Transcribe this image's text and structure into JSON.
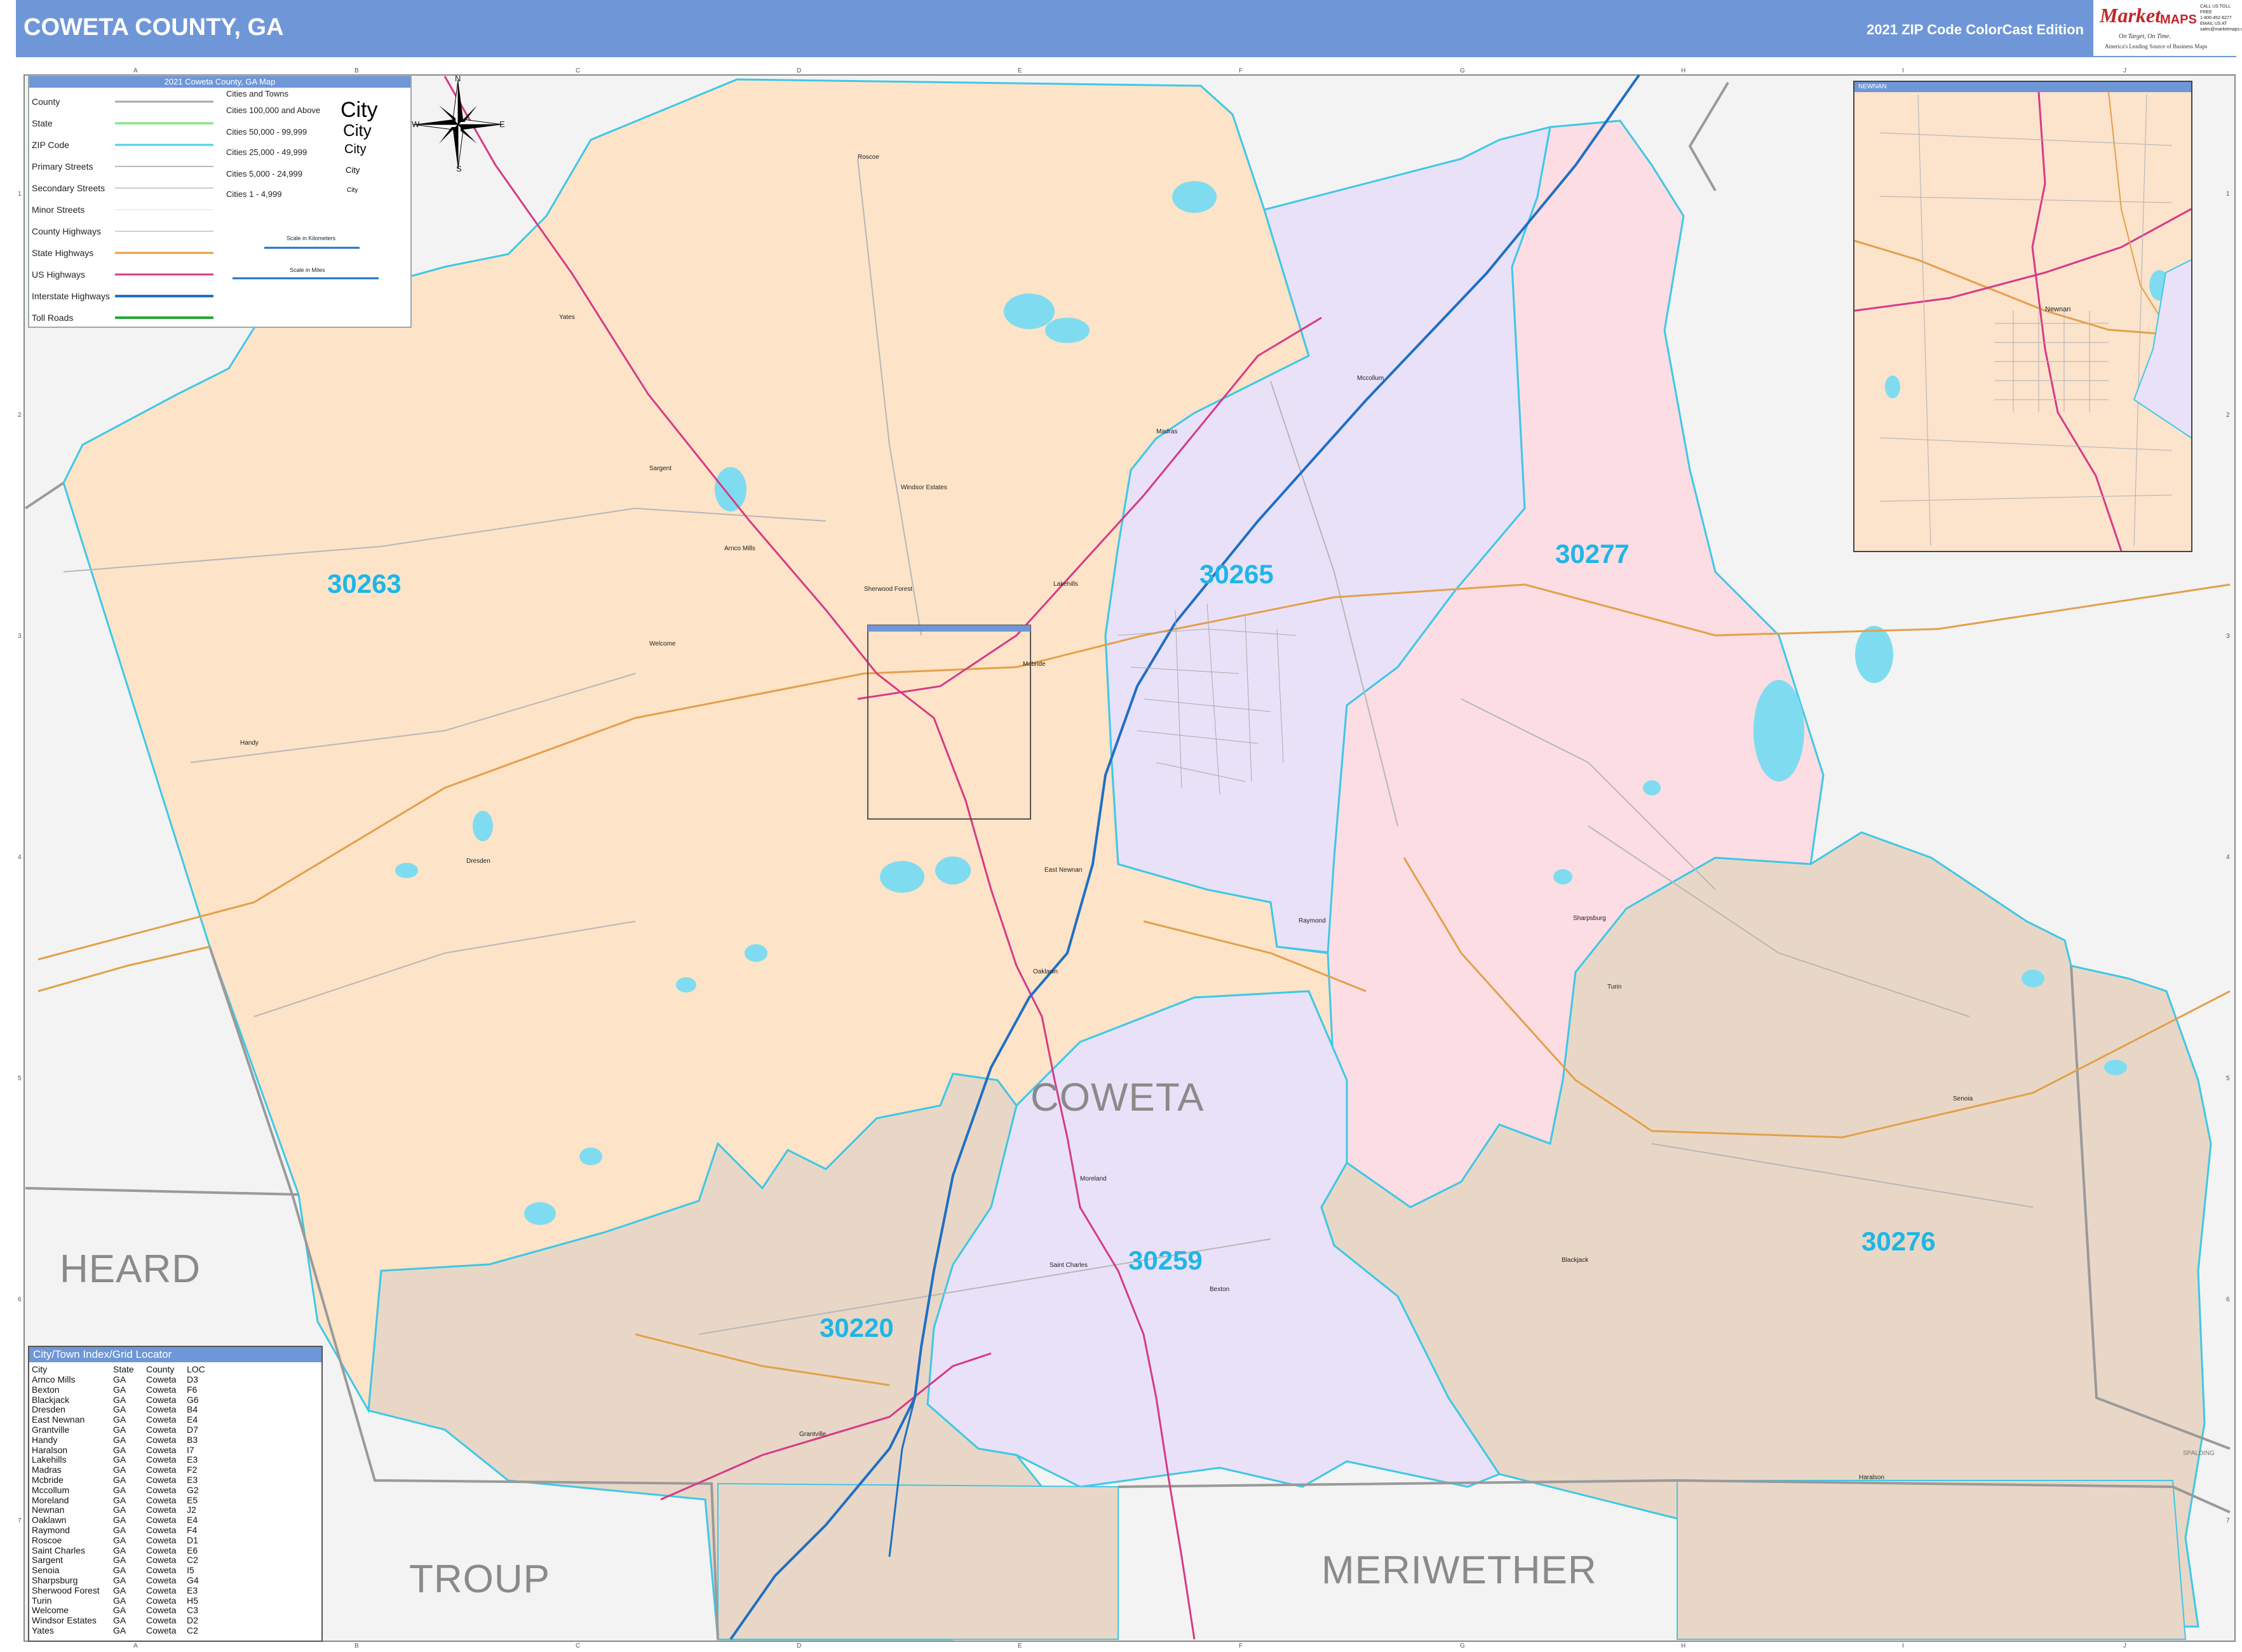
{
  "header": {
    "title": "COWETA COUNTY, GA",
    "edition": "2021 ZIP Code ColorCast Edition",
    "logo": {
      "brand_a": "Market",
      "brand_b": "MAPS",
      "tagline": "On Target, On Time.",
      "tagline2": "America's Leading Source of Business Maps",
      "contact": [
        "CALL US TOLL FREE",
        "1-800-452-6277",
        "EMAIL US AT",
        "sales@marketmaps.com"
      ]
    }
  },
  "grid": {
    "columns": [
      "A",
      "B",
      "C",
      "D",
      "E",
      "F",
      "G",
      "H",
      "I",
      "J"
    ],
    "rows": [
      "1",
      "2",
      "3",
      "4",
      "5",
      "6",
      "7"
    ]
  },
  "legend": {
    "title": "2021 Coweta County, GA Map",
    "items": [
      {
        "label": "County",
        "color": "#aaaaaa"
      },
      {
        "label": "State",
        "color": "#9be59b"
      },
      {
        "label": "ZIP Code",
        "color": "#4fd0e8"
      },
      {
        "label": "Primary Streets",
        "color": "#bbbbbb"
      },
      {
        "label": "Secondary Streets",
        "color": "#cccccc"
      },
      {
        "label": "Minor Streets",
        "color": "#dddddd"
      },
      {
        "label": "County Highways",
        "color": "#c7d2de"
      },
      {
        "label": "State Highways",
        "color": "#e3a04a"
      },
      {
        "label": "US Highways",
        "color": "#d63a86"
      },
      {
        "label": "Interstate Highways",
        "color": "#1f6fc4"
      },
      {
        "label": "Toll Roads",
        "color": "#22aa33"
      }
    ],
    "cities_heading": "Cities and Towns",
    "city_tiers": [
      {
        "label": "Cities 100,000 and Above",
        "sample": "City"
      },
      {
        "label": "Cities 50,000 - 99,999",
        "sample": "City"
      },
      {
        "label": "Cities 25,000 - 49,999",
        "sample": "City"
      },
      {
        "label": "Cities 5,000 - 24,999",
        "sample": "City"
      },
      {
        "label": "Cities 1 - 4,999",
        "sample": "City"
      }
    ],
    "scale_km": "Scale in Kilometers",
    "scale_mi": "Scale in Miles"
  },
  "compass": {
    "n": "N",
    "s": "S",
    "e": "E",
    "w": "W"
  },
  "zip_codes": [
    {
      "code": "30263",
      "color": "#fde3c8"
    },
    {
      "code": "30265",
      "color": "#e9e1f8"
    },
    {
      "code": "30277",
      "color": "#fcdde3"
    },
    {
      "code": "30259",
      "color": "#e9e1f8"
    },
    {
      "code": "30220",
      "color": "#e8d7c7"
    },
    {
      "code": "30276",
      "color": "#e8d7c7"
    }
  ],
  "counties": {
    "main": "COWETA",
    "neighbors": [
      "HEARD",
      "TROUP",
      "MERIWETHER"
    ],
    "small": [
      "SPALDING"
    ]
  },
  "towns": [
    "Roscoe",
    "Yates",
    "Sargent",
    "Windsor Estates",
    "Arnco Mills",
    "Sherwood Forest",
    "Lakehills",
    "Welcome",
    "Handy",
    "Mcbride",
    "Dresden",
    "East Newnan",
    "Raymond",
    "Sharpsburg",
    "Turin",
    "Oaklawn",
    "Moreland",
    "Saint Charles",
    "Bexton",
    "Grantville",
    "Haralson",
    "Senoia",
    "Blackjack",
    "Madras",
    "Mccollum"
  ],
  "inset": {
    "title": "NEWNAN",
    "city": "Newnan"
  },
  "locator": {
    "title": "City/Town Index/Grid Locator",
    "columns": [
      "City",
      "State",
      "County",
      "LOC"
    ],
    "rows": [
      [
        "Arnco Mills",
        "GA",
        "Coweta",
        "D3"
      ],
      [
        "Bexton",
        "GA",
        "Coweta",
        "F6"
      ],
      [
        "Blackjack",
        "GA",
        "Coweta",
        "G6"
      ],
      [
        "Dresden",
        "GA",
        "Coweta",
        "B4"
      ],
      [
        "East Newnan",
        "GA",
        "Coweta",
        "E4"
      ],
      [
        "Grantville",
        "GA",
        "Coweta",
        "D7"
      ],
      [
        "Handy",
        "GA",
        "Coweta",
        "B3"
      ],
      [
        "Haralson",
        "GA",
        "Coweta",
        "I7"
      ],
      [
        "Lakehills",
        "GA",
        "Coweta",
        "E3"
      ],
      [
        "Madras",
        "GA",
        "Coweta",
        "F2"
      ],
      [
        "Mcbride",
        "GA",
        "Coweta",
        "E3"
      ],
      [
        "Mccollum",
        "GA",
        "Coweta",
        "G2"
      ],
      [
        "Moreland",
        "GA",
        "Coweta",
        "E5"
      ],
      [
        "Newnan",
        "GA",
        "Coweta",
        "J2"
      ],
      [
        "Oaklawn",
        "GA",
        "Coweta",
        "E4"
      ],
      [
        "Raymond",
        "GA",
        "Coweta",
        "F4"
      ],
      [
        "Roscoe",
        "GA",
        "Coweta",
        "D1"
      ],
      [
        "Saint Charles",
        "GA",
        "Coweta",
        "E6"
      ],
      [
        "Sargent",
        "GA",
        "Coweta",
        "C2"
      ],
      [
        "Senoia",
        "GA",
        "Coweta",
        "I5"
      ],
      [
        "Sharpsburg",
        "GA",
        "Coweta",
        "G4"
      ],
      [
        "Sherwood Forest",
        "GA",
        "Coweta",
        "E3"
      ],
      [
        "Turin",
        "GA",
        "Coweta",
        "H5"
      ],
      [
        "Welcome",
        "GA",
        "Coweta",
        "C3"
      ],
      [
        "Windsor Estates",
        "GA",
        "Coweta",
        "D2"
      ],
      [
        "Yates",
        "GA",
        "Coweta",
        "C2"
      ]
    ]
  }
}
